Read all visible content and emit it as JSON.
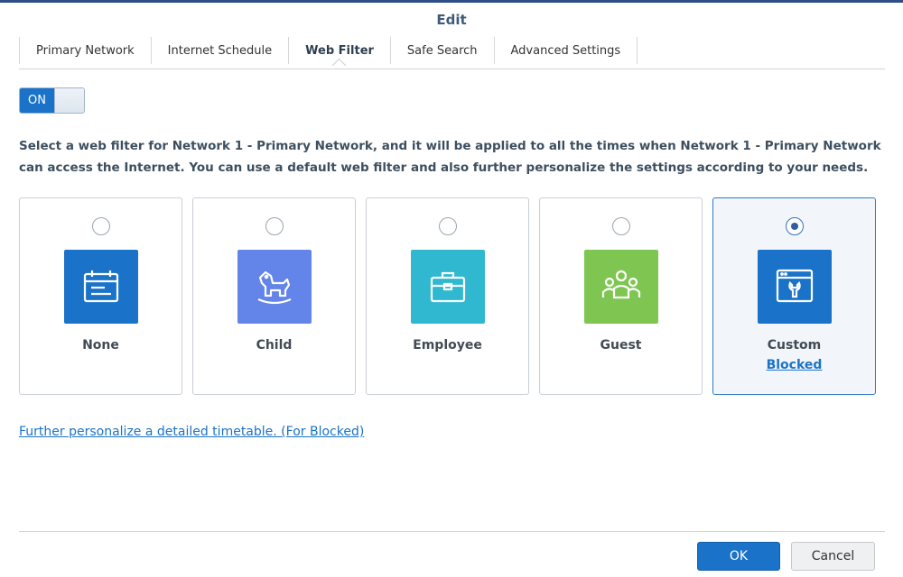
{
  "dialog": {
    "title": "Edit"
  },
  "tabs": [
    {
      "label": "Primary Network"
    },
    {
      "label": "Internet Schedule"
    },
    {
      "label": "Web Filter"
    },
    {
      "label": "Safe Search"
    },
    {
      "label": "Advanced Settings"
    }
  ],
  "active_tab": "Web Filter",
  "toggle": {
    "label": "ON",
    "state": true
  },
  "description": "Select a web filter for Network 1 - Primary Network, and it will be applied to all the times when Network 1 - Primary Network can access the Internet. You can use a default web filter and also further personalize the settings according to your needs.",
  "filters": [
    {
      "label": "None",
      "icon": "calendar-icon",
      "color": "#1a73c8",
      "selected": false
    },
    {
      "label": "Child",
      "icon": "rocking-horse-icon",
      "color": "#6384e8",
      "selected": false
    },
    {
      "label": "Employee",
      "icon": "briefcase-icon",
      "color": "#2fb8cf",
      "selected": false
    },
    {
      "label": "Guest",
      "icon": "group-icon",
      "color": "#7ec651",
      "selected": false
    },
    {
      "label": "Custom",
      "sub_link": "Blocked",
      "icon": "window-wrench-icon",
      "color": "#1a73c8",
      "selected": true
    }
  ],
  "timetable_link": "Further personalize a detailed timetable. (For Blocked)",
  "buttons": {
    "ok": "OK",
    "cancel": "Cancel"
  },
  "colors": {
    "accent": "#1a73c8",
    "header_bar": "#2e4e8a"
  }
}
